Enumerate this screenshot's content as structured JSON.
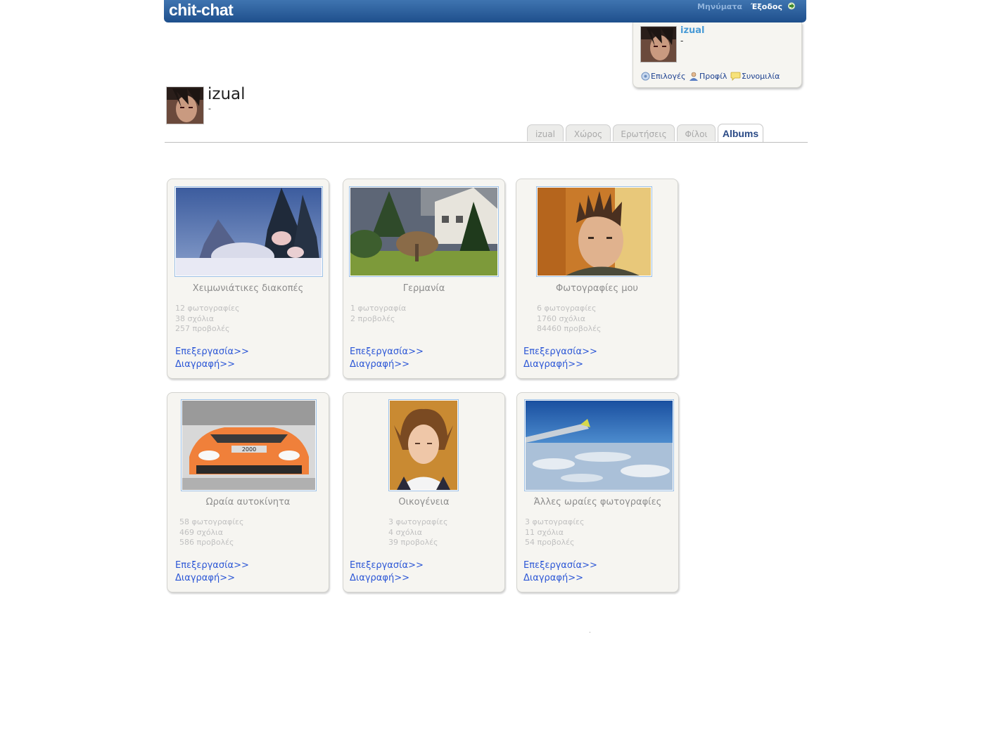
{
  "header": {
    "logo": "chit-chat",
    "nav_messages": "Μηνύματα",
    "nav_logout": "Έξοδος"
  },
  "user_panel": {
    "name": "izual",
    "status": "-",
    "links": {
      "options": "Επιλογές",
      "profile": "Προφίλ",
      "chat": "Συνομιλία"
    }
  },
  "profile": {
    "name": "izual",
    "status": "-"
  },
  "tabs": [
    {
      "label": "izual",
      "active": false
    },
    {
      "label": "Χώρος",
      "active": false
    },
    {
      "label": "Ερωτήσεις",
      "active": false
    },
    {
      "label": "Φίλοι",
      "active": false
    },
    {
      "label": "Albums",
      "active": true
    }
  ],
  "albums": [
    {
      "title": "Χειμωνιάτικες διακοπές",
      "photos": "12 φωτογραφίες",
      "comments": "38 σχόλια",
      "views": "257 προβολές",
      "edit": "Επεξεργασία>>",
      "delete": "Διαγραφή>>"
    },
    {
      "title": "Γερμανία",
      "photos": "1 φωτογραφία",
      "comments": "2 προβολές",
      "views": "",
      "edit": "Επεξεργασία>>",
      "delete": "Διαγραφή>>"
    },
    {
      "title": "Φωτογραφίες μου",
      "photos": "6 φωτογραφίες",
      "comments": "1760 σχόλια",
      "views": "84460 προβολές",
      "edit": "Επεξεργασία>>",
      "delete": "Διαγραφή>>"
    },
    {
      "title": "Ωραία αυτοκίνητα",
      "photos": "58 φωτογραφίες",
      "comments": "469 σχόλια",
      "views": "586 προβολές",
      "edit": "Επεξεργασία>>",
      "delete": "Διαγραφή>>",
      "plate": "2000"
    },
    {
      "title": "Οικογένεια",
      "photos": "3 φωτογραφίες",
      "comments": "4 σχόλια",
      "views": "39 προβολές",
      "edit": "Επεξεργασία>>",
      "delete": "Διαγραφή>>"
    },
    {
      "title": "Άλλες ωραίες φωτογραφίες",
      "photos": "3 φωτογραφίες",
      "comments": "11 σχόλια",
      "views": "54 προβολές",
      "edit": "Επεξεργασία>>",
      "delete": "Διαγραφή>>"
    }
  ],
  "colors": {
    "topbar": "#1e4f8c",
    "link": "#2b56d6",
    "username": "#4a9bd6",
    "card_bg": "#f6f5f1"
  }
}
